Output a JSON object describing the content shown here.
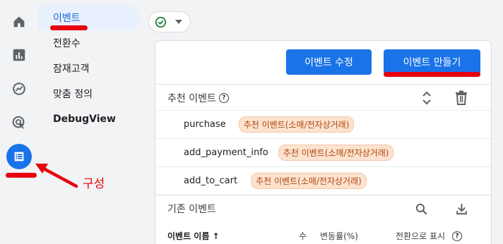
{
  "nav": {
    "items": [
      "이벤트",
      "전환수",
      "잠재고객",
      "맞춤 정의",
      "DebugView"
    ]
  },
  "rail": {
    "icons": [
      "home-icon",
      "reports-icon",
      "explore-icon",
      "advertising-icon",
      "configure-icon"
    ]
  },
  "toolbar": {
    "edit_button": "이벤트 수정",
    "create_button": "이벤트 만들기"
  },
  "recommended": {
    "title": "추천 이벤트",
    "rows": [
      {
        "name": "purchase",
        "tag": "추천 이벤트(소매/전자상거래)"
      },
      {
        "name": "add_payment_info",
        "tag": "추천 이벤트(소매/전자상거래)"
      },
      {
        "name": "add_to_cart",
        "tag": "추천 이벤트(소매/전자상거래)"
      }
    ]
  },
  "existing": {
    "title": "기존 이벤트",
    "columns": [
      "이벤트 이름 ↑",
      "수",
      "변동률(%)",
      "전환으로 표시"
    ]
  },
  "annotation": {
    "label": "구성"
  },
  "colors": {
    "accent": "#1a73e8",
    "annotation": "#e8000f",
    "tag_bg": "#fce3cf"
  }
}
